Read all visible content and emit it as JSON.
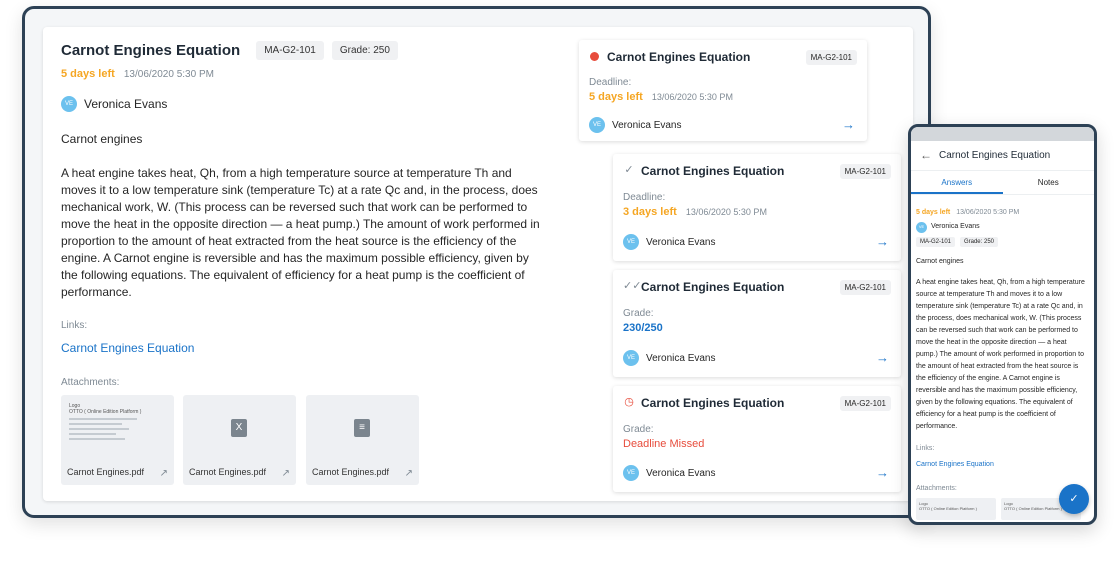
{
  "detail": {
    "title": "Carnot Engines Equation",
    "code": "MA-G2-101",
    "grade": "Grade: 250",
    "days_left": "5 days left",
    "date": "13/06/2020 5:30 PM",
    "avatar_initials": "VE",
    "user": "Veronica Evans",
    "subject": "Carnot engines",
    "body": "A heat engine takes heat, Qh, from a high temperature source at temperature Th and moves it to a low temperature sink (temperature Tc) at a rate Qc and, in the process, does mechanical work, W. (This process can be reversed such that work can be performed to move the heat in the opposite direction — a heat pump.) The amount of work performed in proportion to the amount of heat extracted from the heat source is the efficiency of the engine. A Carnot engine is reversible and has the maximum possible efficiency, given by the following equations. The equivalent of efficiency for a heat pump is the coefficient of performance.",
    "links_label": "Links:",
    "link_text": "Carnot Engines Equation",
    "attachments_label": "Attachments:",
    "attachments": [
      {
        "name": "Carnot Engines.pdf",
        "thumb": "Logo\nOTTO ( Online Edition Platform )"
      },
      {
        "name": "Carnot Engines.pdf",
        "icon": "X"
      },
      {
        "name": "Carnot Engines.pdf",
        "icon": "≡"
      }
    ]
  },
  "tasks": [
    {
      "title": "Carnot Engines Equation",
      "code": "MA-G2-101",
      "label": "Deadline:",
      "value": "5 days left",
      "date": "13/06/2020 5:30 PM",
      "user": "Veronica Evans",
      "icon": "red-dot-icon"
    },
    {
      "title": "Carnot Engines Equation",
      "code": "MA-G2-101",
      "label": "Deadline:",
      "value": "3 days left",
      "date": "13/06/2020 5:30 PM",
      "user": "Veronica Evans",
      "icon": "check-icon"
    },
    {
      "title": "Carnot Engines Equation",
      "code": "MA-G2-101",
      "label": "Grade:",
      "value": "230/250",
      "user": "Veronica Evans",
      "icon": "double-check-icon"
    },
    {
      "title": "Carnot Engines Equation",
      "code": "MA-G2-101",
      "label": "Grade:",
      "value": "Deadline Missed",
      "user": "Veronica Evans",
      "icon": "clock-alert-icon"
    }
  ],
  "phone": {
    "title": "Carnot Engines Equation",
    "tab_answers": "Answers",
    "tab_notes": "Notes",
    "days_left": "5 days left",
    "date": "13/06/2020 5:30 PM",
    "user": "Veronica Evans",
    "code": "MA-G2-101",
    "grade": "Grade: 250",
    "subject": "Carnot engines",
    "body": "A heat engine takes heat, Qh, from a high temperature source at temperature Th and moves it to a low temperature sink (temperature Tc) at a rate Qc and, in the process, does mechanical work, W. (This process can be reversed such that work can be performed to move the heat in the opposite direction — a heat pump.) The amount of work performed in proportion to the amount of heat extracted from the heat source is the efficiency of the engine. A Carnot engine is reversible and has the maximum possible efficiency, given by the following equations. The equivalent of efficiency for a heat pump is the coefficient of performance.",
    "links_label": "Links:",
    "link_text": "Carnot Engines Equation",
    "attachments_label": "Attachments:",
    "att_thumb": "Logo\nOTTO ( Online Edition Platform )"
  }
}
